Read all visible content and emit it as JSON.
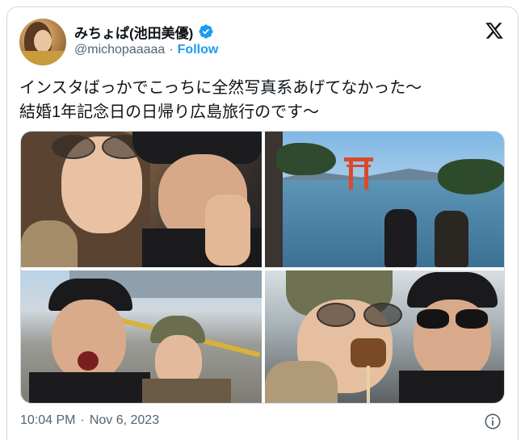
{
  "author": {
    "display_name": "みちょぱ(池田美優)",
    "handle": "@michopaaaaa",
    "separator": "·",
    "follow_label": "Follow"
  },
  "tweet": {
    "text": "インスタばっかでこっちに全然写真系あげてなかった〜\n結婚1年記念日の日帰り広島旅行のです〜"
  },
  "footer": {
    "time": "10:04 PM",
    "separator": "·",
    "date": "Nov 6, 2023"
  },
  "icons": {
    "verified": "verified-badge-icon",
    "platform": "x-logo-icon",
    "info": "info-icon"
  },
  "colors": {
    "accent": "#1d9bf0",
    "text_primary": "#0f1419",
    "text_secondary": "#536471",
    "border": "#cfd9de"
  }
}
